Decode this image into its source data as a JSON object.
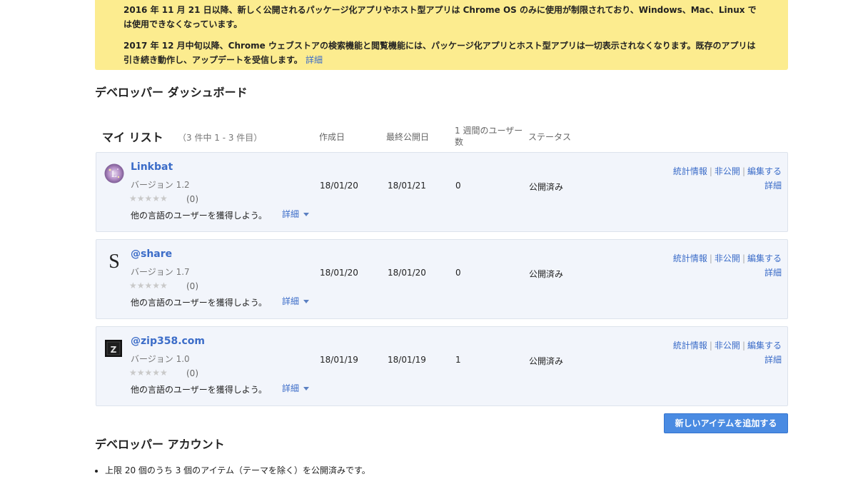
{
  "notice": {
    "line1": "2016 年 11 月 21 日以降、新しく公開されるパッケージ化アプリやホスト型アプリは Chrome OS のみに使用が制限されており、Windows、Mac、Linux では使用できなくなっています。",
    "line2": "2017 年 12 月中旬以降、Chrome ウェブストアの検索機能と閲覧機能には、パッケージ化アプリとホスト型アプリは一切表示されなくなります。既存のアプリは引き続き動作し、アップデートを受信します。",
    "more_link": "詳細",
    "background_color": "#fcec8f"
  },
  "dashboard_title": "デベロッパー ダッシュボード",
  "my_list": {
    "title": "マイ リスト",
    "count": "（3 件中 1 - 3 件目）",
    "columns": {
      "created": "作成日",
      "last_published": "最終公開日",
      "weekly_users": "1 週間のユーザー数",
      "status": "ステータス"
    }
  },
  "items": [
    {
      "name": "Linkbat",
      "icon": "linkbat-logo-icon",
      "version": "バージョン 1.2",
      "stars": "★★★★★",
      "rating_count": "(0)",
      "promo": "他の言語のユーザーを獲得しよう。",
      "promo_link": "詳細",
      "created": "18/01/20",
      "last_published": "18/01/21",
      "weekly_users": "0",
      "status": "公開済み",
      "stats": "統計情報",
      "unpublish": "非公開",
      "edit": "編集する",
      "details": "詳細"
    },
    {
      "name": "@share",
      "icon": "share-logo-icon",
      "version": "バージョン 1.7",
      "stars": "★★★★★",
      "rating_count": "(0)",
      "promo": "他の言語のユーザーを獲得しよう。",
      "promo_link": "詳細",
      "created": "18/01/20",
      "last_published": "18/01/20",
      "weekly_users": "0",
      "status": "公開済み",
      "stats": "統計情報",
      "unpublish": "非公開",
      "edit": "編集する",
      "details": "詳細"
    },
    {
      "name": "@zip358.com",
      "icon": "zip358-logo-icon",
      "version": "バージョン 1.0",
      "stars": "★★★★★",
      "rating_count": "(0)",
      "promo": "他の言語のユーザーを獲得しよう。",
      "promo_link": "詳細",
      "created": "18/01/19",
      "last_published": "18/01/19",
      "weekly_users": "1",
      "status": "公開済み",
      "stats": "統計情報",
      "unpublish": "非公開",
      "edit": "編集する",
      "details": "詳細"
    }
  ],
  "add_button": "新しいアイテムを追加する",
  "account_title": "デベロッパー アカウント",
  "account_info": "上限 20 個のうち 3 個のアイテム（テーマを除く）を公開済みです。",
  "colors": {
    "link": "#3b6cc8",
    "button": "#4a8be2",
    "card_bg": "#f2f5fb"
  }
}
